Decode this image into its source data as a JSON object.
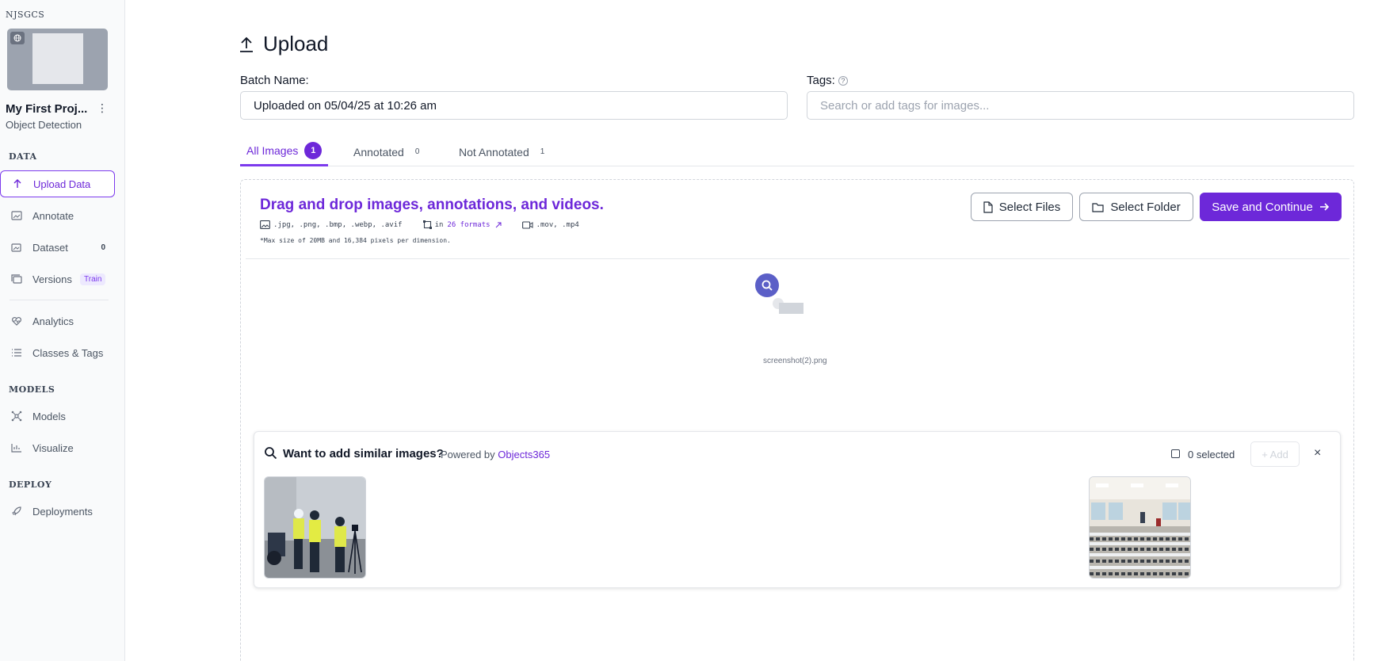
{
  "sidebar": {
    "workspace": "NJSGCS",
    "project_name": "My First Proj...",
    "project_type": "Object Detection",
    "sections": {
      "data": "DATA",
      "models": "MODELS",
      "deploy": "DEPLOY"
    },
    "items": {
      "upload": {
        "label": "Upload Data",
        "icon": "arrow-up-icon"
      },
      "annotate": {
        "label": "Annotate",
        "icon": "image-edit-icon"
      },
      "dataset": {
        "label": "Dataset",
        "icon": "images-icon",
        "count": "0"
      },
      "versions": {
        "label": "Versions",
        "icon": "stack-icon",
        "badge": "Train"
      },
      "analytics": {
        "label": "Analytics",
        "icon": "heart-pulse-icon"
      },
      "classes": {
        "label": "Classes & Tags",
        "icon": "list-icon"
      },
      "models": {
        "label": "Models",
        "icon": "network-icon"
      },
      "visualize": {
        "label": "Visualize",
        "icon": "chart-icon"
      },
      "deployments": {
        "label": "Deployments",
        "icon": "rocket-icon"
      }
    }
  },
  "header": {
    "title": "Upload"
  },
  "batch": {
    "label": "Batch Name:",
    "value": "Uploaded on 05/04/25 at 10:26 am"
  },
  "tags": {
    "label": "Tags:",
    "placeholder": "Search or add tags for images...",
    "help": "?"
  },
  "tabs": {
    "all": {
      "label": "All Images",
      "count": "1"
    },
    "annotated": {
      "label": "Annotated",
      "count": "0"
    },
    "not_annotated": {
      "label": "Not Annotated",
      "count": "1"
    }
  },
  "dropzone": {
    "title": "Drag and drop images, annotations, and videos.",
    "image_formats": ".jpg, .png, .bmp, .webp, .avif",
    "annotation_prefix": "in",
    "annotation_link": "26 formats",
    "video_formats": ".mov, .mp4",
    "note": "*Max size of 20MB and 16,384 pixels per dimension.",
    "file_name": "screenshot(2).png"
  },
  "buttons": {
    "select_files": "Select Files",
    "select_folder": "Select Folder",
    "save_continue": "Save and Continue"
  },
  "similar": {
    "title": "Want to add similar images?",
    "powered_prefix": "Powered by",
    "powered_link": "Objects365",
    "selected": "0 selected",
    "add": "+ Add",
    "close": "×"
  },
  "colors": {
    "accent": "#6d28d9",
    "sidebar_bg": "#f9fafb",
    "border": "#d1d5db"
  }
}
